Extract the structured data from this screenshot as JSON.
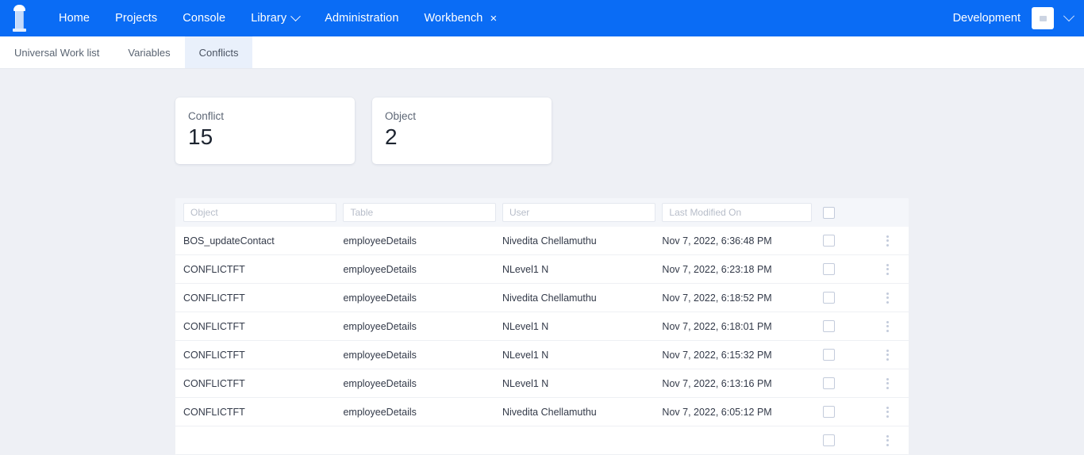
{
  "topbar": {
    "logo_icon": "pillar-logo-icon",
    "nav": [
      {
        "label": "Home",
        "has_caret": false,
        "closable": false
      },
      {
        "label": "Projects",
        "has_caret": false,
        "closable": false
      },
      {
        "label": "Console",
        "has_caret": false,
        "closable": false
      },
      {
        "label": "Library",
        "has_caret": true,
        "closable": false
      },
      {
        "label": "Administration",
        "has_caret": false,
        "closable": false
      },
      {
        "label": "Workbench",
        "has_caret": false,
        "closable": true
      }
    ],
    "close_glyph": "×",
    "environment": "Development",
    "accent_color": "#0a6cf5"
  },
  "subtabs": [
    {
      "label": "Universal Work list",
      "active": false
    },
    {
      "label": "Variables",
      "active": false
    },
    {
      "label": "Conflicts",
      "active": true
    }
  ],
  "cards": [
    {
      "label": "Conflict",
      "value": "15"
    },
    {
      "label": "Object",
      "value": "2"
    }
  ],
  "table": {
    "filters": [
      {
        "name": "object",
        "placeholder": "Object",
        "value": ""
      },
      {
        "name": "table",
        "placeholder": "Table",
        "value": ""
      },
      {
        "name": "user",
        "placeholder": "User",
        "value": ""
      },
      {
        "name": "last-modified-on",
        "placeholder": "Last Modified On",
        "value": ""
      }
    ],
    "select_all_checked": false,
    "rows": [
      {
        "object": "BOS_updateContact",
        "table": "employeeDetails",
        "user": "Nivedita Chellamuthu",
        "modified": "Nov 7, 2022, 6:36:48 PM",
        "checked": false
      },
      {
        "object": "CONFLICTFT",
        "table": "employeeDetails",
        "user": "NLevel1 N",
        "modified": "Nov 7, 2022, 6:23:18 PM",
        "checked": false
      },
      {
        "object": "CONFLICTFT",
        "table": "employeeDetails",
        "user": "Nivedita Chellamuthu",
        "modified": "Nov 7, 2022, 6:18:52 PM",
        "checked": false
      },
      {
        "object": "CONFLICTFT",
        "table": "employeeDetails",
        "user": "NLevel1 N",
        "modified": "Nov 7, 2022, 6:18:01 PM",
        "checked": false
      },
      {
        "object": "CONFLICTFT",
        "table": "employeeDetails",
        "user": "NLevel1 N",
        "modified": "Nov 7, 2022, 6:15:32 PM",
        "checked": false
      },
      {
        "object": "CONFLICTFT",
        "table": "employeeDetails",
        "user": "NLevel1 N",
        "modified": "Nov 7, 2022, 6:13:16 PM",
        "checked": false
      },
      {
        "object": "CONFLICTFT",
        "table": "employeeDetails",
        "user": "Nivedita Chellamuthu",
        "modified": "Nov 7, 2022, 6:05:12 PM",
        "checked": false
      },
      {
        "object": "",
        "table": "",
        "user": "",
        "modified": "",
        "checked": false
      }
    ]
  }
}
